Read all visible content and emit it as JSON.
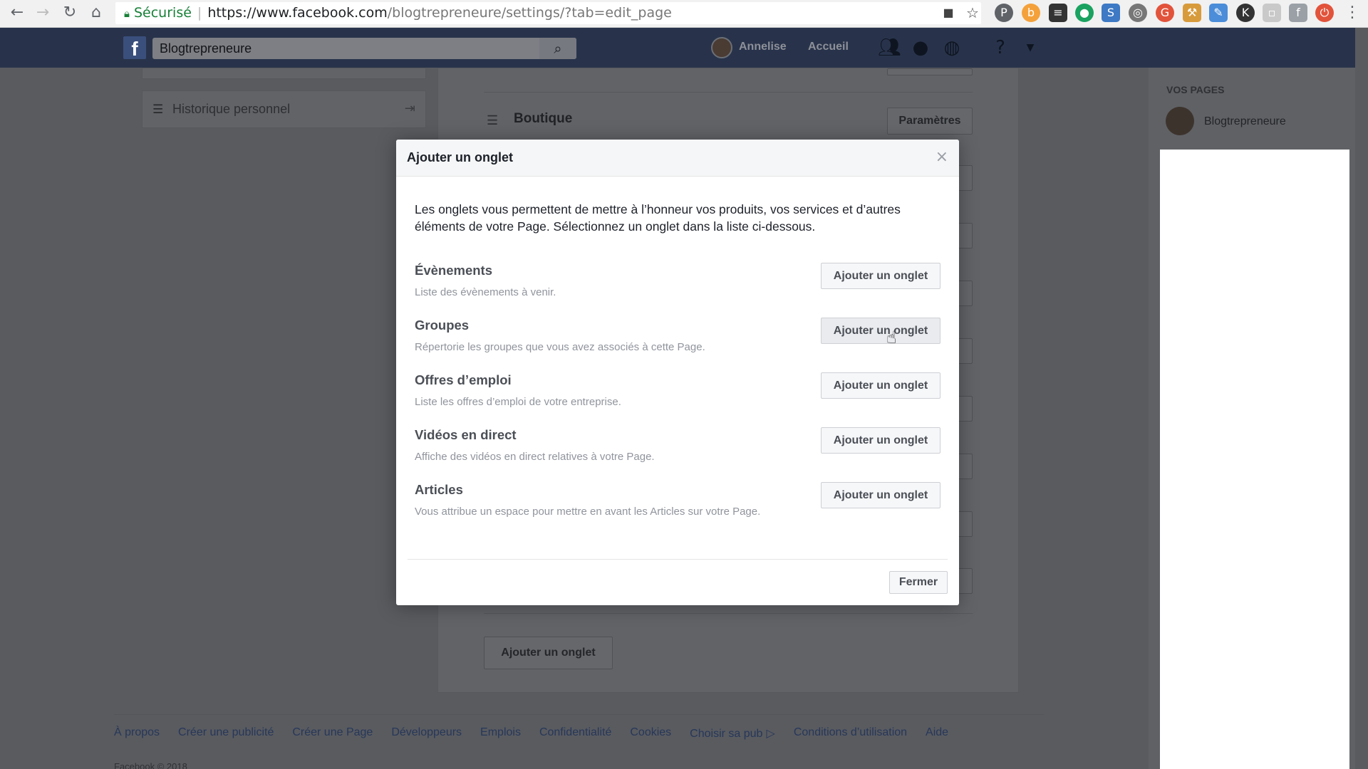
{
  "browser": {
    "secure_label": "Sécurisé",
    "url_host": "https://www.facebook.com",
    "url_path": "/blogtrepreneure/settings/?tab=edit_page"
  },
  "header": {
    "search_value": "Blogtrepreneure",
    "user_name": "Annelise",
    "home_label": "Accueil"
  },
  "left": {
    "history_label": "Historique personnel"
  },
  "center": {
    "boutique_label": "Boutique",
    "settings_label": "Paramètres",
    "add_tab_label": "Ajouter un onglet"
  },
  "right": {
    "your_pages_label": "VOS PAGES",
    "page_name": "Blogtrepreneure"
  },
  "modal": {
    "title": "Ajouter un onglet",
    "close_symbol": "×",
    "intro": "Les onglets vous permettent de mettre à l’honneur vos produits, vos services et d’autres éléments de votre Page. Sélectionnez un onglet dans la liste ci-dessous.",
    "tabs": [
      {
        "name": "Évènements",
        "description": "Liste des évènements à venir.",
        "button": "Ajouter un onglet"
      },
      {
        "name": "Groupes",
        "description": "Répertorie les groupes que vous avez associés à cette Page.",
        "button": "Ajouter un onglet"
      },
      {
        "name": "Offres d’emploi",
        "description": "Liste les offres d’emploi de votre entreprise.",
        "button": "Ajouter un onglet"
      },
      {
        "name": "Vidéos en direct",
        "description": "Affiche des vidéos en direct relatives à votre Page.",
        "button": "Ajouter un onglet"
      },
      {
        "name": "Articles",
        "description": "Vous attribue un espace pour mettre en avant les Articles sur votre Page.",
        "button": "Ajouter un onglet"
      }
    ],
    "close_button": "Fermer"
  },
  "footer": {
    "links": [
      "À propos",
      "Créer une publicité",
      "Créer une Page",
      "Développeurs",
      "Emplois",
      "Confidentialité",
      "Cookies",
      "Choisir sa pub",
      "Conditions d’utilisation",
      "Aide"
    ],
    "copyright": "Facebook © 2018"
  },
  "colors": {
    "fb_blue": "#3b5998",
    "overlay_bg": "#595b5f",
    "modal_bg": "#ffffff"
  }
}
